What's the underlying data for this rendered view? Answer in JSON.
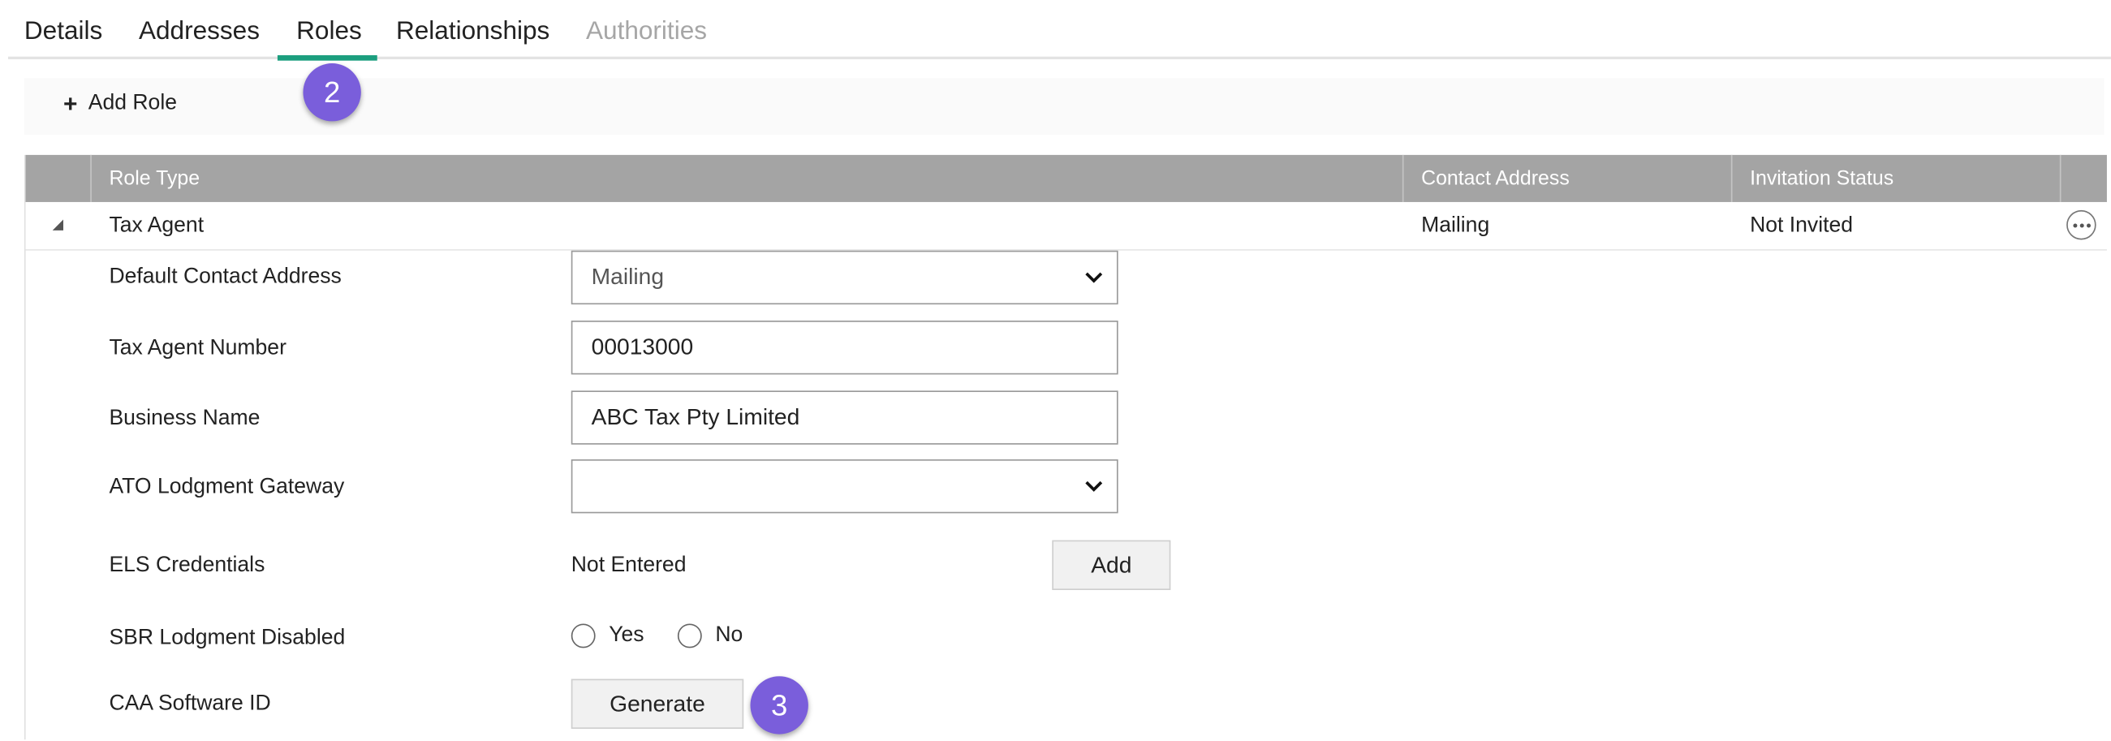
{
  "tabs": [
    {
      "label": "Details"
    },
    {
      "label": "Addresses"
    },
    {
      "label": "Roles"
    },
    {
      "label": "Relationships"
    },
    {
      "label": "Authorities"
    }
  ],
  "badges": {
    "roles_step": "2",
    "generate_step": "3"
  },
  "toolbar": {
    "add_role_label": "Add Role",
    "add_icon": "plus-icon"
  },
  "grid": {
    "columns": [
      "Role Type",
      "Contact Address",
      "Invitation Status"
    ],
    "rows": [
      {
        "role_type": "Tax Agent",
        "contact_address": "Mailing",
        "invitation_status": "Not Invited"
      }
    ]
  },
  "detail": {
    "default_contact_address": {
      "label": "Default Contact Address",
      "value": "Mailing"
    },
    "tax_agent_number": {
      "label": "Tax Agent Number",
      "value": "00013000"
    },
    "business_name": {
      "label": "Business Name",
      "value": "ABC Tax Pty Limited"
    },
    "ato_lodgment_gateway": {
      "label": "ATO Lodgment Gateway",
      "value": ""
    },
    "els_credentials": {
      "label": "ELS Credentials",
      "value": "Not Entered",
      "button": "Add"
    },
    "sbr_lodgment_disabled": {
      "label": "SBR Lodgment Disabled",
      "options": [
        "Yes",
        "No"
      ]
    },
    "caa_software_id": {
      "label": "CAA Software ID",
      "button": "Generate"
    }
  },
  "colors": {
    "accent": "#1b9e7e",
    "badge": "#7a5edb",
    "header_bg": "#a4a4a4"
  }
}
